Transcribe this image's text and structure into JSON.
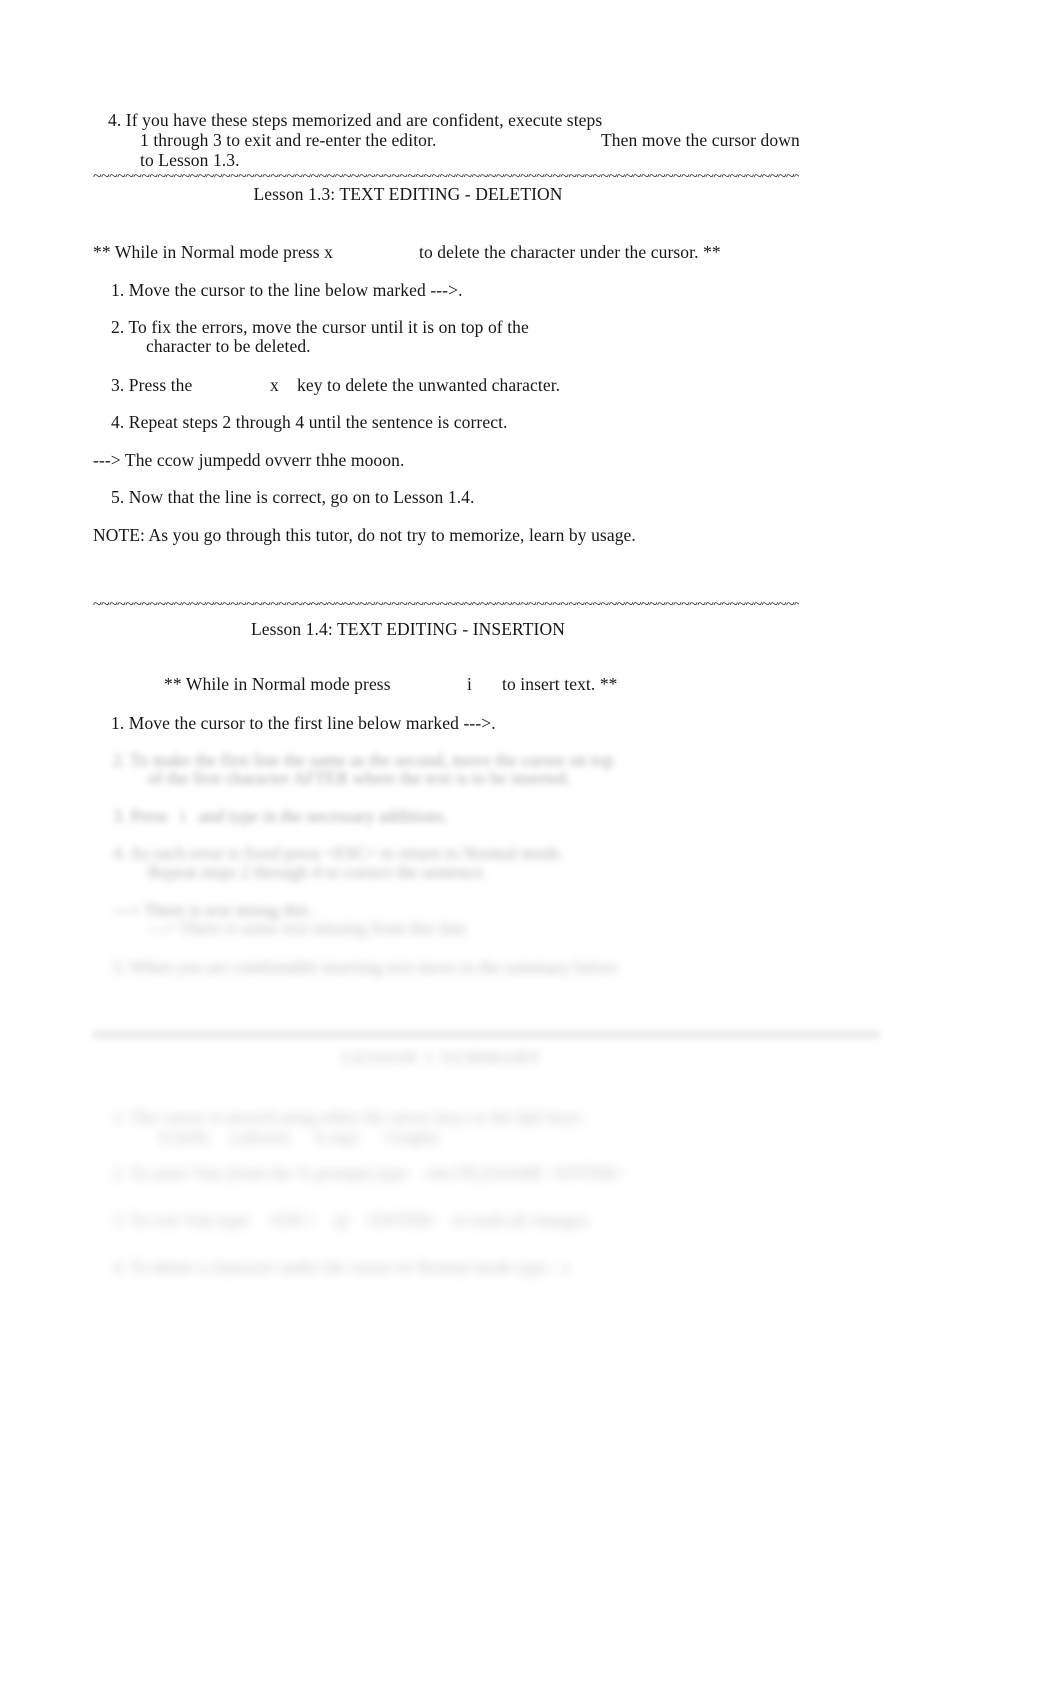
{
  "document": {
    "kind": "vimtutor-lesson-page",
    "background_color": "#ffffff",
    "text_color": "#161616"
  },
  "top_section": {
    "step4_line1": "4. If you have these steps memorized and are confident, execute steps",
    "step4_line2": "1 through 3 to exit and re-enter the editor.",
    "step4_line2_right": "Then move the cursor down",
    "step4_line3": "to Lesson 1.3.",
    "separator": "~~~~~~~~~~~~~~~~~~~~~~~~~~~~~~~~~~~~~~~~~~~~~~~~~~~~~~~~~~~~~~~~~~~~~~~~~~~~~~~~~~~~~~~~~~~~~~~~~~~~~~~~~~~~~~~~~~~~~~~~~~~~~~~~~~~~~~~~~~~~~~~~~~~~~~~~",
    "lesson_title": "Lesson 1.3: TEXT EDITING - DELETION"
  },
  "lesson_1_3": {
    "banner_left": "** While in Normal mode press x",
    "banner_right": "to delete the character under the cursor. **",
    "step1": "1. Move the cursor to the line below marked --->.",
    "step2_line1": "2. To fix the errors, move the cursor until it is on top of the",
    "step2_line2": "character to be deleted.",
    "step3_left": "3. Press the",
    "step3_key": "x",
    "step3_right": "key to delete the unwanted character.",
    "step4": "4. Repeat steps 2 through 4 until the sentence is correct.",
    "practice_line": "---> The ccow jumpedd ovverr thhe mooon.",
    "step5": "5. Now that the line is correct, go on to Lesson 1.4.",
    "note": "NOTE: As you go through this tutor, do not try to memorize, learn by usage."
  },
  "lesson_1_4": {
    "separator": "~~~~~~~~~~~~~~~~~~~~~~~~~~~~~~~~~~~~~~~~~~~~~~~~~~~~~~~~~~~~~~~~~~~~~~~~~~~~~~~~~~~~~~~~~~~~~~~~~~~~~~~~~~~~~~~~~~~~~~~~~~~~~~~~~~~~~~~~~~~~~~~~~~~~~~~~",
    "lesson_title": "Lesson 1.4: TEXT EDITING - INSERTION",
    "banner_left": "** While in Normal mode press",
    "banner_key": "i",
    "banner_right": "to insert text. **",
    "step1": "1. Move the cursor to the first line below marked --->."
  },
  "blurred_region": {
    "note": "lower portion of page is out of focus and illegible",
    "block_a": [
      "2. To make the first line the same as the second, move the cursor on top",
      "of the first character AFTER where the text is to be inserted.",
      "3. Press   i   and type in the necessary additions.",
      "4. As each error is fixed press <ESC> to return to Normal mode.",
      "Repeat steps 2 through 4 to correct the sentence.",
      "---> There is text misng this .",
      "---> There is some text missing from this line.",
      "5. When you are comfortable inserting text move to the summary below."
    ],
    "divider_heading": "LESSON 1 SUMMARY",
    "block_b": [
      "1. The cursor is moved using either the arrow keys or the hjkl keys.",
      "h (left)     j (down)      k (up)      l (right)",
      "2. To enter Vim (from the % prompt) type:   vim FILENAME <ENTER>",
      "3. To exit Vim type:   <ESC>   :q!   <ENTER>   to trash all changes.",
      "4. To delete a character under the cursor in Normal mode type:  x"
    ]
  }
}
